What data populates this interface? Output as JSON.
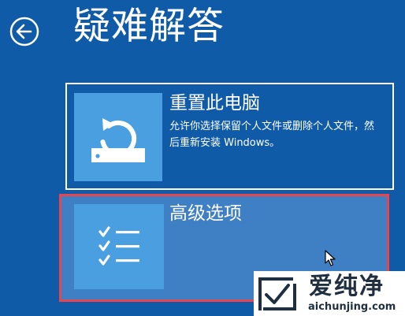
{
  "header": {
    "title": "疑难解答",
    "back_icon": "back-arrow-icon"
  },
  "options": [
    {
      "title": "重置此电脑",
      "description": "允许你选择保留个人文件或删除个人文件，然后重新安装 Windows。",
      "icon": "reset-pc-icon"
    },
    {
      "title": "高级选项",
      "icon": "checklist-icon",
      "selected": true
    }
  ],
  "watermark": {
    "brand": "爱纯净",
    "domain": "aichunjing.com",
    "logo_icon": "brand-logo-icon"
  },
  "colors": {
    "background": "#0f5ba8",
    "tile": "#4a9fe0",
    "selected_background": "#3f7fc4",
    "selected_border": "#e8454f"
  }
}
